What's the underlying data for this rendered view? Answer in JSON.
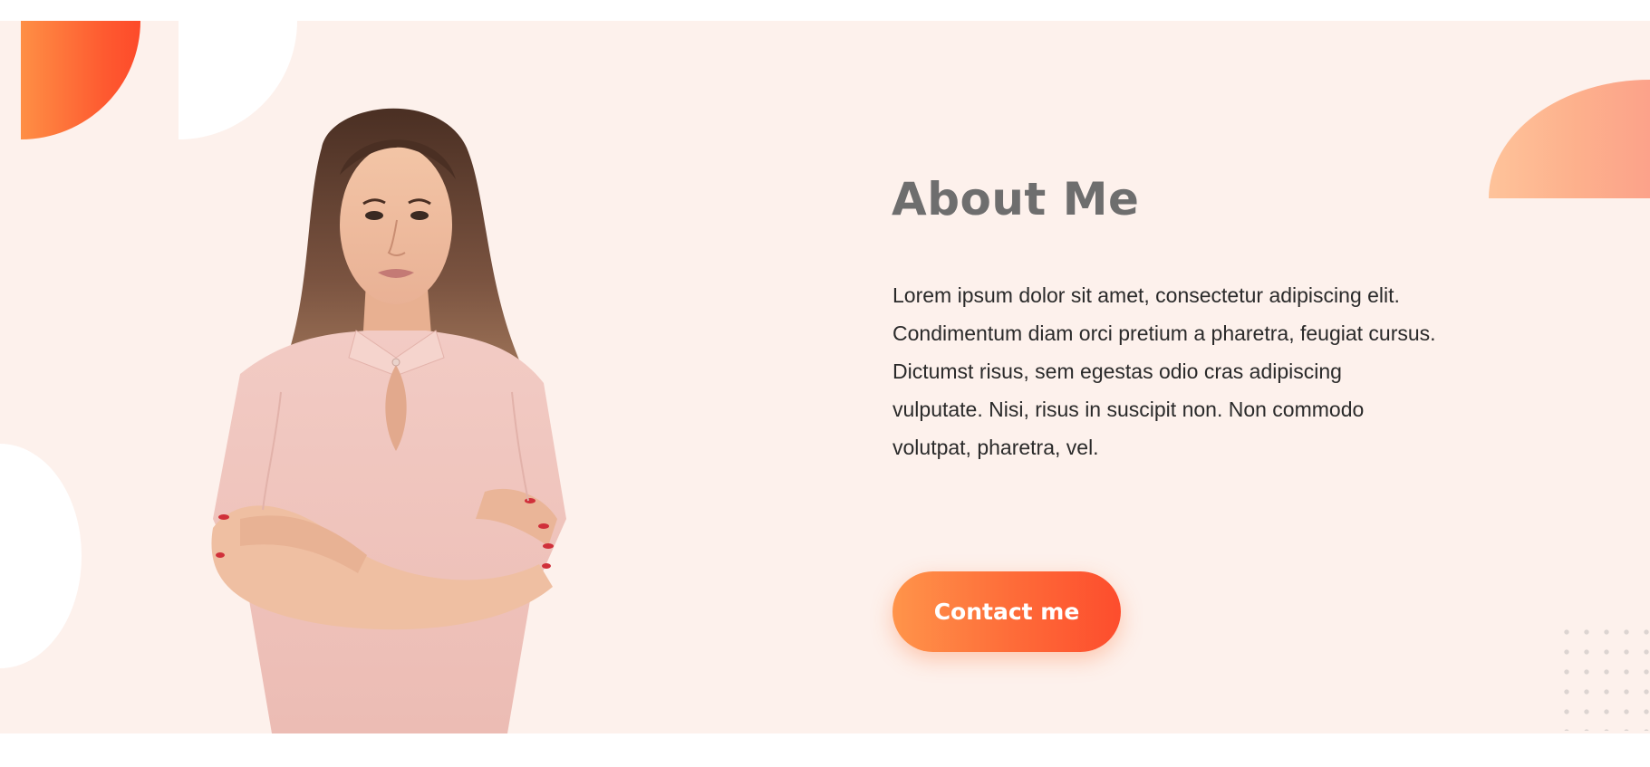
{
  "about": {
    "title": "About Me",
    "description": "Lorem ipsum dolor sit amet, consectetur adipiscing elit. Condimentum diam orci pretium a pharetra, feugiat cursus. Dictumst risus, sem egestas odio cras adipiscing vulputate. Nisi, risus in suscipit non. Non commodo volutpat, pharetra, vel.",
    "contact_button": "Contact me"
  },
  "colors": {
    "section_background": "#fdf1ec",
    "accent_gradient_start": "#ff944a",
    "accent_gradient_end": "#fd4d2d",
    "title": "#6e6e6e",
    "body_text": "#2a2a2a"
  },
  "images": {
    "portrait": "woman-portrait"
  }
}
